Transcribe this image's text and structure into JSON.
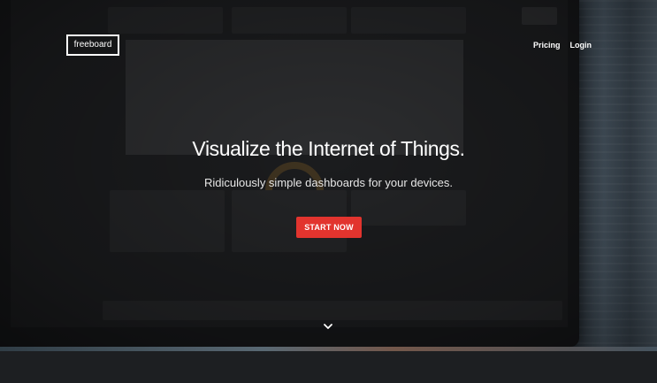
{
  "nav": {
    "logo": "freeboard",
    "links": [
      "Pricing",
      "Login"
    ]
  },
  "hero": {
    "headline": "Visualize the Internet of Things.",
    "subheadline": "Ridiculously simple dashboards for your devices.",
    "cta_label": "START NOW",
    "scroll_icon": "chevron-down-icon"
  },
  "colors": {
    "accent": "#e2342e",
    "background": "#151618",
    "text": "#ffffff"
  }
}
